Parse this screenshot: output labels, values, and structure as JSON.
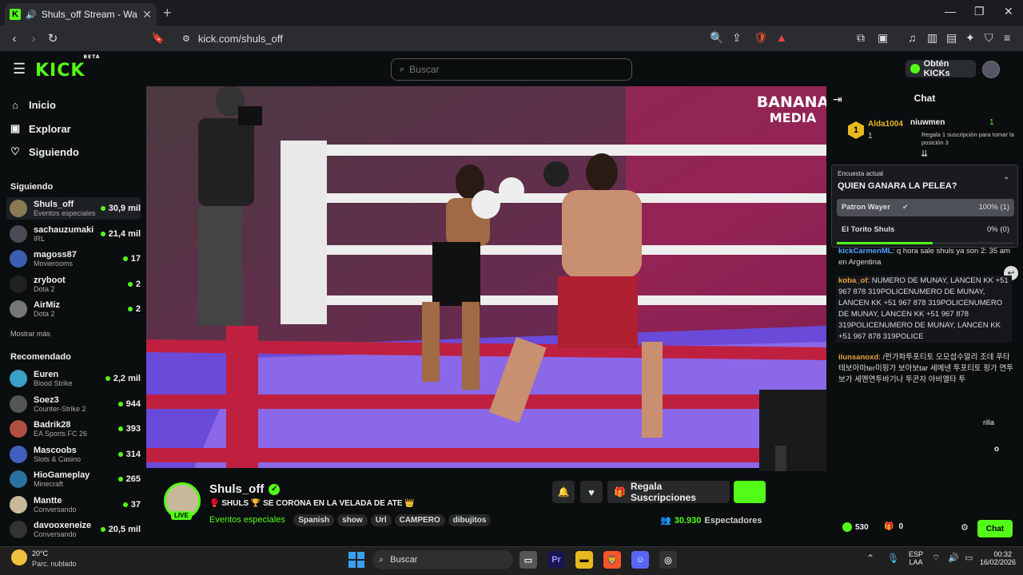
{
  "browser": {
    "tab_title": "Shuls_off Stream - Watch Live",
    "url": "kick.com/shuls_off"
  },
  "header": {
    "logo": "KICK",
    "logo_badge": "BETA",
    "search_placeholder": "Buscar",
    "kicks_button": "Obtén KICKs"
  },
  "sidebar": {
    "nav": [
      {
        "label": "Inicio",
        "icon": "home-icon"
      },
      {
        "label": "Explorar",
        "icon": "compass-icon"
      },
      {
        "label": "Siguiendo",
        "icon": "heart-icon"
      }
    ],
    "following_title": "Siguiendo",
    "following": [
      {
        "name": "Shuls_off",
        "category": "Eventos especiales",
        "viewers": "30,9 mil",
        "color": "#8a7a55"
      },
      {
        "name": "sachauzumaki",
        "category": "IRL",
        "viewers": "21,4 mil",
        "color": "#4a4a55"
      },
      {
        "name": "magoss87",
        "category": "Movierooms",
        "viewers": "17",
        "color": "#3a5fb0"
      },
      {
        "name": "zryboot",
        "category": "Dota 2",
        "viewers": "2",
        "color": "#222222"
      },
      {
        "name": "AirMiz",
        "category": "Dota 2",
        "viewers": "2",
        "color": "#777777"
      }
    ],
    "show_more": "Mostrar más",
    "recommended_title": "Recomendado",
    "recommended": [
      {
        "name": "Euren",
        "category": "Blood Strike",
        "viewers": "2,2 mil",
        "color": "#3aa0c8"
      },
      {
        "name": "Soez3",
        "category": "Counter-Strike 2",
        "viewers": "944",
        "color": "#555555"
      },
      {
        "name": "Badrik28",
        "category": "EA Sports FC 26",
        "viewers": "393",
        "color": "#b05040"
      },
      {
        "name": "Mascoobs",
        "category": "Slots & Casino",
        "viewers": "314",
        "color": "#4060c0"
      },
      {
        "name": "HioGameplay",
        "category": "Minecraft",
        "viewers": "265",
        "color": "#2a70a0"
      },
      {
        "name": "Mantte",
        "category": "Conversando",
        "viewers": "37",
        "color": "#c8b89a"
      },
      {
        "name": "davooxeneize",
        "category": "Conversando",
        "viewers": "20,5 mil",
        "color": "#333333"
      }
    ]
  },
  "video": {
    "watermark_top": "BANANA",
    "watermark_bottom": "MEDIA"
  },
  "stream": {
    "channel_name": "Shuls_off",
    "live_label": "LIVE",
    "title": "🥊 SHULS 🏆 SE CORONA EN LA VELADA DE ATE 👑",
    "category": "Eventos especiales",
    "tags": [
      "Spanish",
      "show",
      "Url",
      "CAMPERO",
      "dibujitos"
    ],
    "subscribe_label": "Regala Suscripciones",
    "viewers_count": "30.930",
    "viewers_label": "Espectadores"
  },
  "chat": {
    "title": "Chat",
    "leader_name": "Alda1004",
    "leader_rank": "1",
    "leader_count": "1",
    "second_name": "niuwmen",
    "second_count": "1",
    "second_sub": "Regala 1 suscripción para tomar la posición 3",
    "poll": {
      "label": "Encuesta actual",
      "question": "QUIEN GANARA LA PELEA?",
      "options": [
        {
          "name": "Patron Wayer",
          "result": "100% (1)",
          "fraction": 1.0
        },
        {
          "name": "El Torito Shuls",
          "result": "0% (0)",
          "fraction": 0.0
        }
      ],
      "time_remaining_fraction": 0.54
    },
    "messages": [
      {
        "user": "kickCarmenML",
        "text": "q hora sale shuls ya son 2: 35 am en Argentina",
        "color": "#53a0ff"
      },
      {
        "user": "koba_of",
        "text": "NUMERO DE MUNAY, LANCEN KK +51 967 878 319POLICENUMERO DE MUNAY, LANCEN KK +51 967 878 319POLICENUMERO DE MUNAY, LANCEN KK +51 967 878 319POLICENUMERO DE MUNAY, LANCEN KK +51 967 878 319POLICE",
        "color": "#e6a23c"
      },
      {
        "user": "ilunsanoxd",
        "text": "/펀가파투포티토 오모셥수알리 조데 푸타 테보아마ter미핑가 보아보tar 세메넨 투포티토 핑가 연투보가 세멘연투바기나 투콘자 아비엘타 투",
        "color": "#e6a23c"
      }
    ],
    "partial_text_1": "rilla",
    "partial_text_2": "o",
    "points": "530",
    "subs": "0",
    "chat_button": "Chat"
  },
  "taskbar": {
    "weather_temp": "20°C",
    "weather_desc": "Parc. nublado",
    "search_label": "Buscar",
    "lang_top": "ESP",
    "lang_bottom": "LAA",
    "time": "00:32",
    "date": "16/02/2026"
  }
}
